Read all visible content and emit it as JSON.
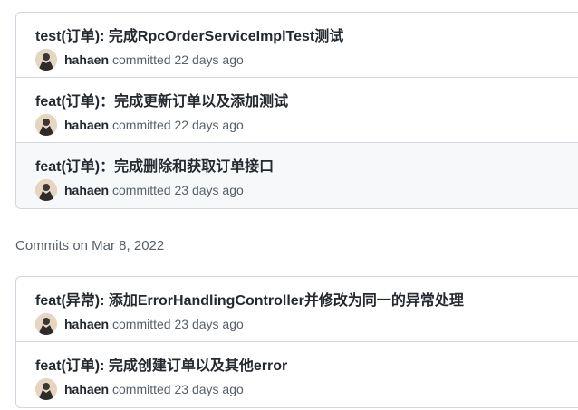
{
  "groups": [
    {
      "heading": "",
      "commits": [
        {
          "title": "test(订单): 完成RpcOrderServiceImplTest测试",
          "author": "hahaen",
          "action": "committed",
          "time": "22 days ago"
        },
        {
          "title": "feat(订单)：完成更新订单以及添加测试",
          "author": "hahaen",
          "action": "committed",
          "time": "22 days ago"
        },
        {
          "title": "feat(订单)：完成删除和获取订单接口",
          "author": "hahaen",
          "action": "committed",
          "time": "23 days ago"
        }
      ]
    },
    {
      "heading": "Commits on Mar 8, 2022",
      "commits": [
        {
          "title": "feat(异常): 添加ErrorHandlingController并修改为同一的异常处理",
          "author": "hahaen",
          "action": "committed",
          "time": "23 days ago"
        },
        {
          "title": "feat(订单): 完成创建订单以及其他error",
          "author": "hahaen",
          "action": "committed",
          "time": "23 days ago"
        }
      ]
    }
  ],
  "icons": {
    "avatar": "user-avatar"
  },
  "colors": {
    "border": "#d0d7de",
    "muted": "#57606a",
    "text": "#24292f",
    "hover_bg": "#f6f8fa"
  }
}
